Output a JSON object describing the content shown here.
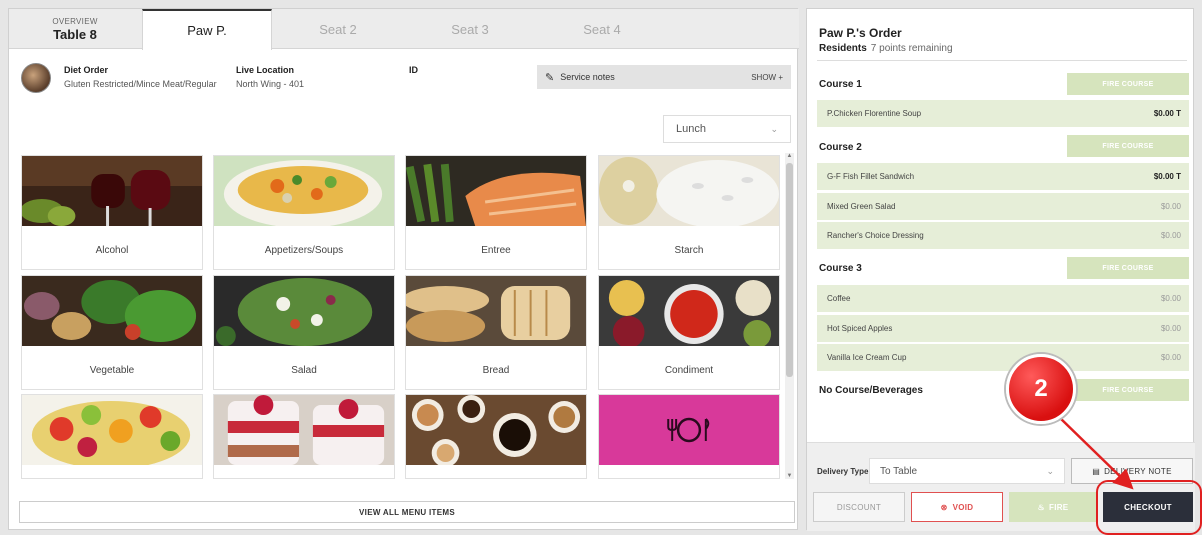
{
  "tabs": {
    "overview_small": "OVERVIEW",
    "overview_table": "Table 8",
    "active": "Paw P.",
    "seat2": "Seat 2",
    "seat3": "Seat 3",
    "seat4": "Seat 4"
  },
  "resident": {
    "diet_label": "Diet Order",
    "diet_value": "Gluten Restricted/Mince Meat/Regular",
    "location_label": "Live Location",
    "location_value": "North Wing - 401",
    "id_label": "ID",
    "service_notes": "Service notes",
    "show": "SHOW +"
  },
  "meal_select": "Lunch",
  "categories": [
    {
      "label": "Alcohol",
      "image": "wine-glasses"
    },
    {
      "label": "Appetizers/Soups",
      "image": "soup-bowl"
    },
    {
      "label": "Entree",
      "image": "salmon-asparagus"
    },
    {
      "label": "Starch",
      "image": "rice-potato"
    },
    {
      "label": "Vegetable",
      "image": "vegetables"
    },
    {
      "label": "Salad",
      "image": "salad-bowl"
    },
    {
      "label": "Bread",
      "image": "bread-loaves"
    },
    {
      "label": "Condiment",
      "image": "sauces"
    },
    {
      "label": "",
      "image": "fruit-salad"
    },
    {
      "label": "",
      "image": "parfait"
    },
    {
      "label": "",
      "image": "coffee-cups"
    },
    {
      "label": "",
      "image": "plate-cutlery-icon"
    }
  ],
  "view_all": "VIEW ALL MENU ITEMS",
  "order": {
    "title": "Paw P.'s Order",
    "plan": "Residents",
    "points": "7 points remaining",
    "fire_label": "FIRE COURSE",
    "courses": [
      {
        "name": "Course 1",
        "items": [
          {
            "name": "P.Chicken Florentine Soup",
            "price": "$0.00 T",
            "bold": true
          }
        ]
      },
      {
        "name": "Course 2",
        "items": [
          {
            "name": "G-F Fish Fillet Sandwich",
            "price": "$0.00 T",
            "bold": true
          },
          {
            "name": "Mixed Green Salad",
            "price": "$0.00",
            "bold": false
          },
          {
            "name": "Rancher's Choice Dressing",
            "price": "$0.00",
            "bold": false
          }
        ]
      },
      {
        "name": "Course 3",
        "items": [
          {
            "name": "Coffee",
            "price": "$0.00",
            "bold": false
          },
          {
            "name": "Hot Spiced Apples",
            "price": "$0.00",
            "bold": false
          },
          {
            "name": "Vanilla Ice Cream Cup",
            "price": "$0.00",
            "bold": false
          }
        ]
      },
      {
        "name": "No Course/Beverages",
        "items": []
      }
    ]
  },
  "footer": {
    "delivery_type_label": "Delivery Type",
    "delivery_type_value": "To Table",
    "delivery_note": "DELIVERY NOTE",
    "discount": "DISCOUNT",
    "void": "VOID",
    "fire": "FIRE",
    "checkout": "CHECKOUT"
  },
  "annotation": {
    "step": "2"
  },
  "colors": {
    "fire_green": "#d6e4bd",
    "item_green": "#e6eed8",
    "checkout_dark": "#2b2f3a",
    "void_red": "#e05050",
    "annotation_red": "#d91010"
  }
}
